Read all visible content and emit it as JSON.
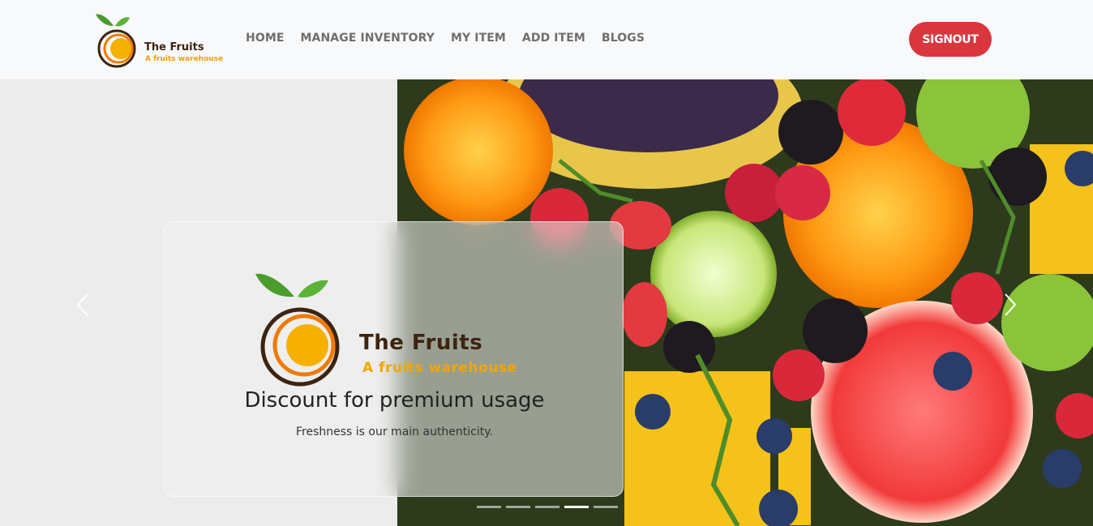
{
  "brand": {
    "title": "The Fruits",
    "subtitle": "A fruits warehouse"
  },
  "nav": {
    "items": [
      {
        "label": "HOME"
      },
      {
        "label": "MANAGE INVENTORY"
      },
      {
        "label": "MY ITEM"
      },
      {
        "label": "ADD ITEM"
      },
      {
        "label": "BLOGS"
      }
    ],
    "signout_label": "SIGNOUT"
  },
  "carousel": {
    "slide_count": 5,
    "active_index": 3,
    "caption": {
      "logo_title": "The Fruits",
      "logo_subtitle": "A fruits warehouse",
      "title": "Discount for premium usage",
      "text": "Freshness is our main authenticity."
    }
  },
  "colors": {
    "signout": "#d9363e",
    "brand_dark": "#3d2410",
    "brand_orange": "#f2a600",
    "leaf_green": "#4a9d2c",
    "nav_text": "#6f6f6f"
  },
  "icons": {
    "prev": "chevron-left-icon",
    "next": "chevron-right-icon"
  }
}
